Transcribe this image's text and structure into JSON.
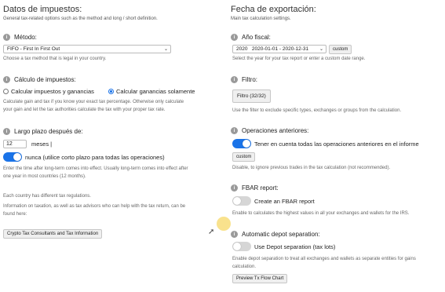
{
  "left": {
    "title": "Datos de impuestos:",
    "desc": "General tax-related options such as the method and long / short definition.",
    "method": {
      "label": "Método:",
      "value": "FIFO - First In First Out",
      "help": "Choose a tax method that is legal in your country."
    },
    "calc": {
      "label": "Cálculo de impuestos:",
      "option1": "Calcular impuestos y ganancias",
      "option2": "Calcular ganancias solamente",
      "selected": "option2",
      "help1": "Calculate gain and tax if you know your exact tax percentage. Otherwise only calculate",
      "help2": "your gain and let the tax authorities calculate the tax with your proper tax rate."
    },
    "longterm": {
      "label": "Largo plazo después de:",
      "value": "12",
      "unit": "meses |",
      "toggle_label": "nunca (utilice corto plazo para todas las operaciones)",
      "toggle_on": true,
      "help1": "Enter the time after long-term comes into effect. Usually long-term comes into effect after",
      "help2": "one year in most countries (12 months)."
    },
    "country": {
      "line1": "Each country has different tax regulations.",
      "line2": "Information on taxation, as well as tax advisors who can help with the tax return, can be",
      "line3": "found here:",
      "button": "Crypto Tax Consultants and Tax Information"
    }
  },
  "right": {
    "title": "Fecha de exportación:",
    "desc": "Main tax calculation settings.",
    "year": {
      "label": "Año fiscal:",
      "value": "2020   2020-01-01 - 2020-12-31",
      "custom": "custom",
      "help": "Select the year for your tax report or enter a custom date range."
    },
    "filter": {
      "label": "Filtro:",
      "value": "Filtro (32/32)",
      "help": "Use the filter to exclude specific types, exchanges or groups from the calculation."
    },
    "previous": {
      "label": "Operaciones anteriores:",
      "toggle_label": "Tener en cuenta todas las operaciones anteriores en el informe",
      "toggle_on": true,
      "custom": "custom",
      "help": "Disable, to ignore previous trades in the tax calculation (not recommended)."
    },
    "fbar": {
      "label": "FBAR report:",
      "toggle_label": "Create an FBAR report",
      "toggle_on": false,
      "help": "Enable to calculates the highest values in all your exchanges and wallets for the IRS."
    },
    "depot": {
      "label": "Automatic depot separation:",
      "toggle_label": "Use Depot separation (tax lots)",
      "toggle_on": false,
      "help1": "Enable depot separation to treat all exchanges and wallets as separate entities for gains",
      "help2": "calculation.",
      "button": "Preview Tx Flow Chart"
    }
  },
  "colors": {
    "accent": "#1a73e8",
    "toggle_off": "#d6d6d6",
    "highlight": "#f6d250"
  }
}
